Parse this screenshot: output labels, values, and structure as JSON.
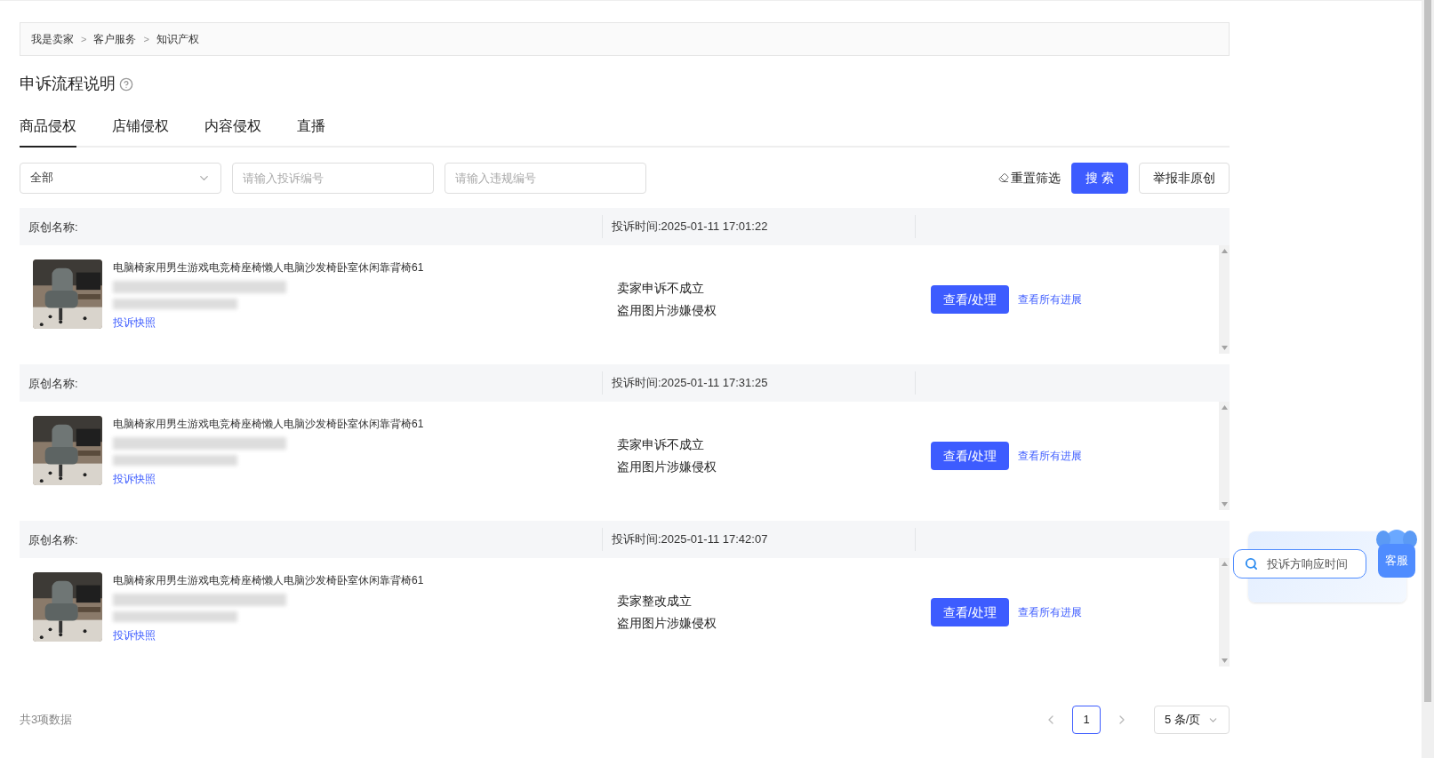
{
  "breadcrumb": [
    "我是卖家",
    "客户服务",
    "知识产权"
  ],
  "breadcrumb_separator": ">",
  "page_title": "申诉流程说明",
  "tabs": [
    {
      "label": "商品侵权",
      "selected": true
    },
    {
      "label": "店铺侵权",
      "selected": false
    },
    {
      "label": "内容侵权",
      "selected": false
    },
    {
      "label": "直播",
      "selected": false
    }
  ],
  "filters": {
    "type_select": {
      "value": "全部"
    },
    "complaint_no": {
      "placeholder": "请输入投诉编号"
    },
    "violation_no": {
      "placeholder": "请输入违规编号"
    },
    "reset": "重置筛选",
    "search": "搜 索",
    "report": "举报非原创"
  },
  "records": [
    {
      "original_name_label": "原创名称:",
      "complaint_time": "投诉时间:2025-01-11 17:01:22",
      "product_title": "电脑椅家用男生游戏电竞椅座椅懒人电脑沙发椅卧室休闲靠背椅61",
      "snapshot_link": "投诉快照",
      "status": "卖家申诉不成立",
      "reason": "盗用图片涉嫌侵权",
      "action": "查看/处理",
      "progress_link": "查看所有进展"
    },
    {
      "original_name_label": "原创名称:",
      "complaint_time": "投诉时间:2025-01-11 17:31:25",
      "product_title": "电脑椅家用男生游戏电竞椅座椅懒人电脑沙发椅卧室休闲靠背椅61",
      "snapshot_link": "投诉快照",
      "status": "卖家申诉不成立",
      "reason": "盗用图片涉嫌侵权",
      "action": "查看/处理",
      "progress_link": "查看所有进展"
    },
    {
      "original_name_label": "原创名称:",
      "complaint_time": "投诉时间:2025-01-11 17:42:07",
      "product_title": "电脑椅家用男生游戏电竞椅座椅懒人电脑沙发椅卧室休闲靠背椅61",
      "snapshot_link": "投诉快照",
      "status": "卖家整改成立",
      "reason": "盗用图片涉嫌侵权",
      "action": "查看/处理",
      "progress_link": "查看所有进展"
    }
  ],
  "footer": {
    "total": "共3项数据",
    "pages": [
      {
        "label": "1",
        "selected": true
      }
    ],
    "page_size": "5 条/页"
  },
  "assistant": {
    "search_chip": "投诉方响应时间",
    "service_button": "客服"
  }
}
